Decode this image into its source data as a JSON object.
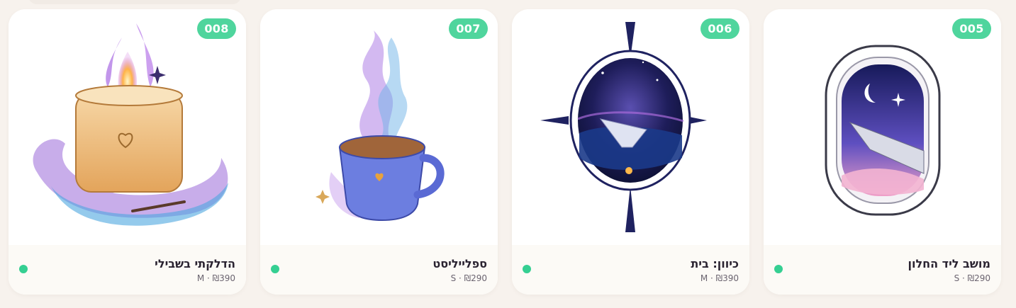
{
  "products": [
    {
      "code": "008",
      "title": "הדלקתי בשבילי",
      "meta": "M · ₪390",
      "image_icon": "candle-icon"
    },
    {
      "code": "007",
      "title": "ספלייליסט",
      "meta": "S · ₪290",
      "image_icon": "mug-icon"
    },
    {
      "code": "006",
      "title": "כיוון: בית",
      "meta": "M · ₪390",
      "image_icon": "compass-icon"
    },
    {
      "code": "005",
      "title": "מושב ליד החלון",
      "meta": "S · ₪290",
      "image_icon": "airplane-window-icon"
    }
  ],
  "colors": {
    "badge": "#4fd59d",
    "status_dot": "#35cf92",
    "background": "#f7f2ed"
  }
}
